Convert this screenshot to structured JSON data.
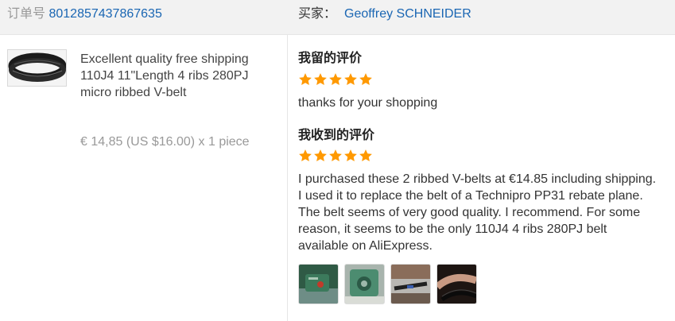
{
  "header": {
    "order_label": "订单号",
    "order_number": "8012857437867635",
    "buyer_label": "买家：",
    "buyer_name": "Geoffrey SCHNEIDER"
  },
  "product": {
    "image_icon": "rubber-belt-icon",
    "title": "Excellent quality free shipping 110J4 11\"Length 4 ribs 280PJ micro ribbed V-belt",
    "price": "€ 14,85 (US $16.00) x 1 piece"
  },
  "my_review": {
    "heading": "我留的评价",
    "rating": 5,
    "max_rating": 5,
    "text": "thanks for your shopping"
  },
  "received_review": {
    "heading": "我收到的评价",
    "rating": 5,
    "max_rating": 5,
    "text": "I purchased these 2 ribbed V-belts at €14.85 including shipping. I used it to replace the belt of a Technipro PP31 rebate plane. The belt seems of very good quality. I recommend. For some reason, it seems to be the only 110J4 4 ribs 280PJ belt available on AliExpress.",
    "photos": [
      "photo-icon",
      "photo-icon",
      "photo-icon",
      "photo-icon"
    ]
  },
  "colors": {
    "header_bg": "#f2f2f2",
    "link": "#1a66b3",
    "star": "#ff9900",
    "divider": "#e6e6e6"
  }
}
